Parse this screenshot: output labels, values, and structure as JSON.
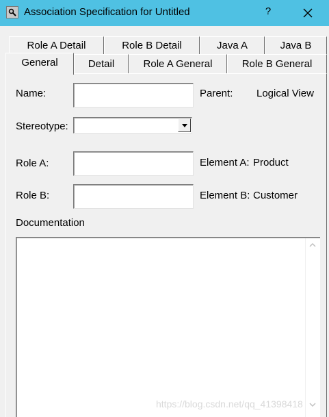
{
  "window": {
    "title": "Association Specification for Untitled",
    "help_label": "?",
    "close_icon": "close-icon",
    "app_icon": "magnifier-icon",
    "title_bar_color": "#4fc1e3"
  },
  "tabs": {
    "back_row": [
      "Role A Detail",
      "Role B Detail",
      "Java A",
      "Java B"
    ],
    "front_row": [
      "General",
      "Detail",
      "Role A General",
      "Role B General"
    ],
    "selected": "General"
  },
  "general": {
    "name_label": "Name:",
    "name_value": "",
    "parent_label": "Parent:",
    "parent_value": "Logical View",
    "stereotype_label": "Stereotype:",
    "stereotype_value": "",
    "role_a_label": "Role A:",
    "role_a_value": "",
    "element_a_label": "Element A:",
    "element_a_value": "Product",
    "role_b_label": "Role B:",
    "role_b_value": "",
    "element_b_label": "Element B:",
    "element_b_value": "Customer",
    "documentation_label": "Documentation",
    "documentation_value": ""
  },
  "watermark": "https://blog.csdn.net/qq_41398418"
}
